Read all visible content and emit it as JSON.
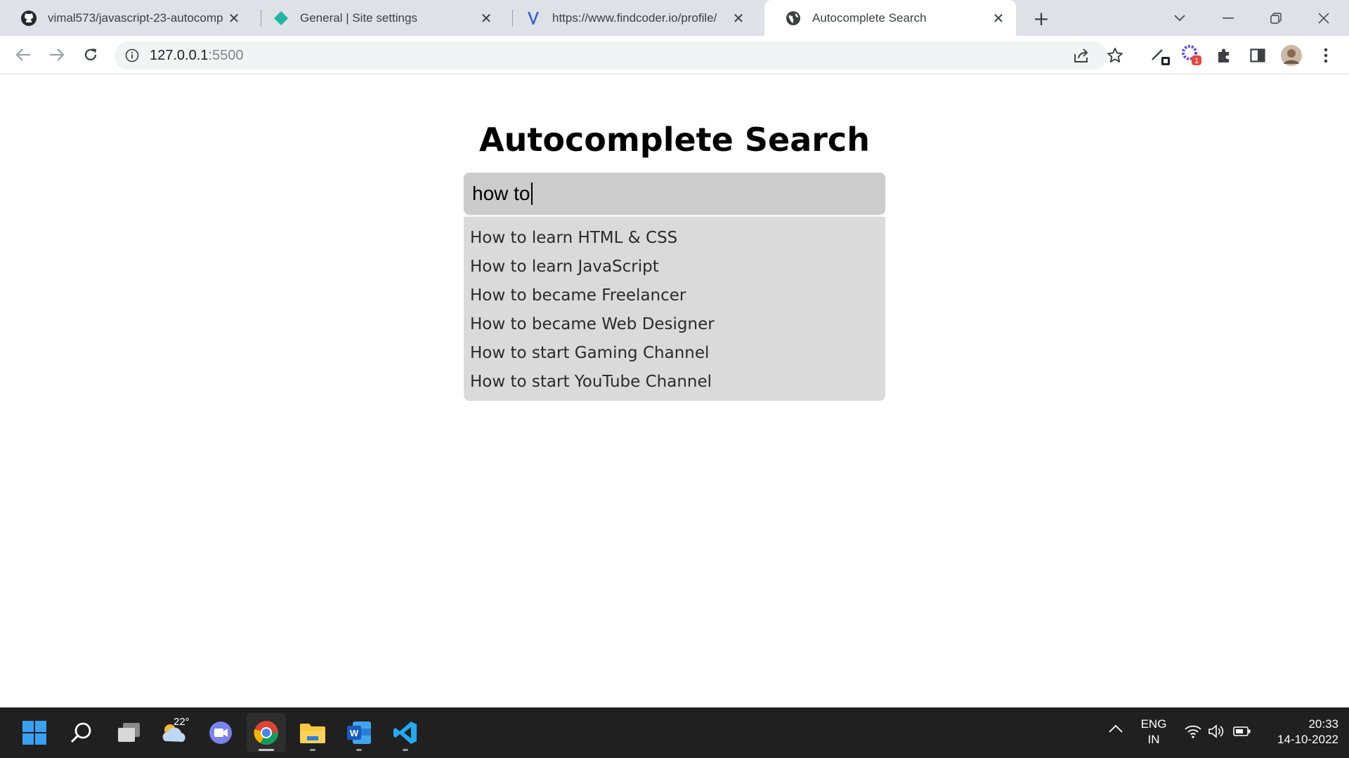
{
  "browser": {
    "tabs": [
      {
        "title": "vimal573/javascript-23-autocomp",
        "icon": "github-icon",
        "active": false
      },
      {
        "title": "General | Site settings",
        "icon": "diamond-icon",
        "active": false
      },
      {
        "title": "https://www.findcoder.io/profile/",
        "icon": "findcoder-icon",
        "active": false
      },
      {
        "title": "Autocomplete Search",
        "icon": "globe-icon",
        "active": true
      }
    ],
    "new_tab_symbol": "+",
    "url": {
      "host": "127.0.0.1",
      "port": ":5500"
    },
    "extension_badge": "1"
  },
  "page": {
    "title": "Autocomplete Search",
    "search": {
      "value": "how to",
      "placeholder": ""
    },
    "suggestions": [
      "How to learn HTML & CSS",
      "How to learn JavaScript",
      "How to became Freelancer",
      "How to became Web Designer",
      "How to start Gaming Channel",
      "How to start YouTube Channel"
    ]
  },
  "taskbar": {
    "weather_temp": "22°",
    "language": {
      "line1": "ENG",
      "line2": "IN"
    },
    "time": "20:33",
    "date": "14-10-2022"
  },
  "colors": {
    "tabstrip_bg": "#dee1e6",
    "input_bg": "#cccccc",
    "suggestions_bg": "#dadada",
    "taskbar_bg": "#202020"
  }
}
